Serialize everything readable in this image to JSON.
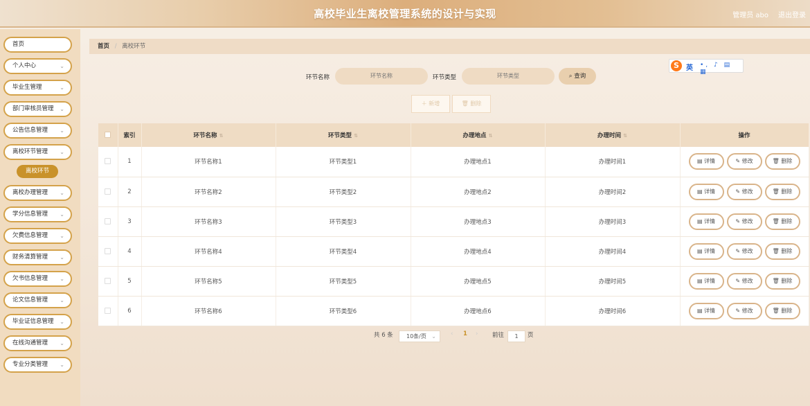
{
  "header": {
    "title": "高校毕业生离校管理系统的设计与实现",
    "user": "管理员 abo",
    "logout": "退出登录"
  },
  "sidebar": {
    "items": [
      {
        "label": "首页",
        "has_chevron": false
      },
      {
        "label": "个人中心",
        "has_chevron": true
      },
      {
        "label": "毕业生管理",
        "has_chevron": true
      },
      {
        "label": "部门审核员管理",
        "has_chevron": true
      },
      {
        "label": "公告信息管理",
        "has_chevron": true
      },
      {
        "label": "离校环节管理",
        "has_chevron": true
      },
      {
        "label": "离校办理管理",
        "has_chevron": true
      },
      {
        "label": "学分信息管理",
        "has_chevron": true
      },
      {
        "label": "欠费信息管理",
        "has_chevron": true
      },
      {
        "label": "财务清算管理",
        "has_chevron": true
      },
      {
        "label": "欠书信息管理",
        "has_chevron": true
      },
      {
        "label": "论文信息管理",
        "has_chevron": true
      },
      {
        "label": "毕业证信息管理",
        "has_chevron": true
      },
      {
        "label": "在线沟通管理",
        "has_chevron": true
      },
      {
        "label": "专业分类管理",
        "has_chevron": true
      }
    ],
    "active_sub": "离校环节"
  },
  "breadcrumb": {
    "home": "首页",
    "separator": "/",
    "current": "离校环节"
  },
  "search": {
    "name_label": "环节名称",
    "name_placeholder": "环节名称",
    "type_label": "环节类型",
    "type_placeholder": "环节类型",
    "button": "查询"
  },
  "ime": {
    "label": "英"
  },
  "actions": {
    "add": "＋ 新增",
    "delete": "🗑 删除"
  },
  "table": {
    "headers": [
      "索引",
      "环节名称",
      "环节类型",
      "办理地点",
      "办理时间",
      "操作"
    ],
    "rows": [
      {
        "index": "1",
        "name": "环节名称1",
        "type": "环节类型1",
        "place": "办理地点1",
        "time": "办理时间1"
      },
      {
        "index": "2",
        "name": "环节名称2",
        "type": "环节类型2",
        "place": "办理地点2",
        "time": "办理时间2"
      },
      {
        "index": "3",
        "name": "环节名称3",
        "type": "环节类型3",
        "place": "办理地点3",
        "time": "办理时间3"
      },
      {
        "index": "4",
        "name": "环节名称4",
        "type": "环节类型4",
        "place": "办理地点4",
        "time": "办理时间4"
      },
      {
        "index": "5",
        "name": "环节名称5",
        "type": "环节类型5",
        "place": "办理地点5",
        "time": "办理时间5"
      },
      {
        "index": "6",
        "name": "环节名称6",
        "type": "环节类型6",
        "place": "办理地点6",
        "time": "办理时间6"
      }
    ],
    "op_detail": "详情",
    "op_edit": "修改",
    "op_delete": "删除"
  },
  "pagination": {
    "total": "共 6 条",
    "page_size": "10条/页",
    "current_page": "1",
    "goto_label": "前往",
    "goto_value": "1",
    "page_unit": "页"
  },
  "colors": {
    "accent": "#c9922a",
    "header_bg": "#efdcc4",
    "border": "#d9b48a"
  }
}
